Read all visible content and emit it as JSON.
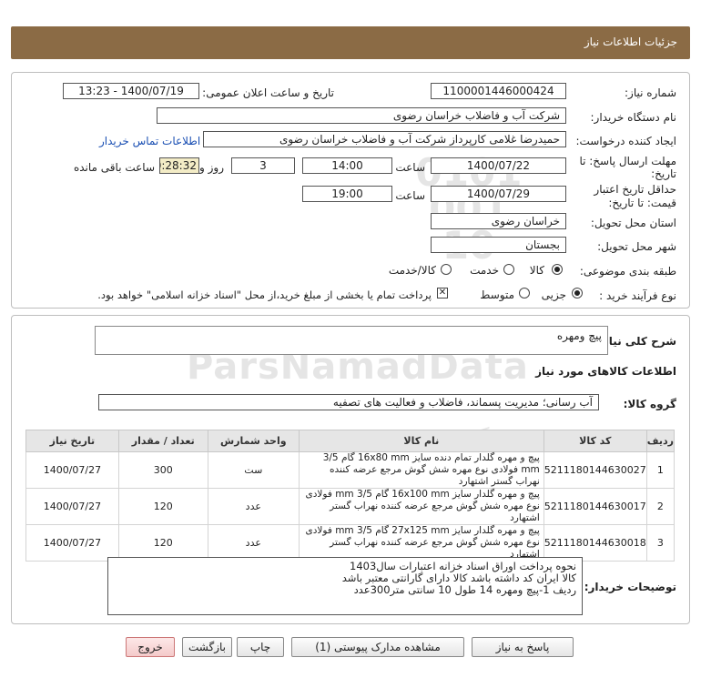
{
  "page": {
    "title": "جزئیات اطلاعات نیاز"
  },
  "form": {
    "need_number_label": "شماره نیاز:",
    "need_number": "1100001446000424",
    "announce_label": "تاریخ و ساعت اعلان عمومی:",
    "announce_value": "1400/07/19 - 13:23",
    "buyer_org_label": "نام دستگاه خریدار:",
    "buyer_org": "شرکت آب و فاضلاب خراسان رضوی",
    "creator_label": "ایجاد کننده درخواست:",
    "creator": "حمیدرضا غلامی کارپرداز شرکت آب و فاضلاب خراسان رضوی",
    "contact_link": "اطلاعات تماس خریدار",
    "deadline_label_1": "مهلت ارسال پاسخ: تا",
    "deadline_label_2": "تاریخ:",
    "deadline_date": "1400/07/22",
    "time_label": "ساعت",
    "deadline_time": "14:00",
    "days_count": "3",
    "days_label": "روز و",
    "remaining_time": "00:28:32",
    "remaining_label": "ساعت باقی مانده",
    "validity_label_1": "حداقل تاریخ اعتبار",
    "validity_label_2": "قیمت: تا تاریخ:",
    "validity_date": "1400/07/29",
    "validity_time_label": "ساعت",
    "validity_time": "19:00",
    "province_label": "استان محل تحویل:",
    "province": "خراسان رضوی",
    "city_label": "شهر محل تحویل:",
    "city": "بجستان",
    "category_label": "طبقه بندی موضوعی:",
    "category_options": [
      "کالا",
      "خدمت",
      "کالا/خدمت"
    ],
    "process_label": "نوع فرآیند خرید :",
    "process_options": [
      "جزیی",
      "متوسط"
    ],
    "payment_note": "پرداخت تمام یا بخشی از مبلغ خرید،از محل \"اسناد خزانه اسلامی\" خواهد بود."
  },
  "need": {
    "summary_label": "شرح کلی نیاز:",
    "summary": "پیچ ومهره",
    "goods_info_title": "اطلاعات کالاهای مورد نیاز",
    "group_label": "گروه کالا:",
    "group": "آب رسانی؛ مدیریت پسماند، فاضلاب و فعالیت های تصفیه"
  },
  "table": {
    "headers": [
      "ردیف",
      "کد کالا",
      "نام کالا",
      "واحد شمارش",
      "تعداد / مقدار",
      "تاریخ نیاز"
    ],
    "rows": [
      {
        "row": "1",
        "code": "5211180144630027",
        "name": "پیچ و مهره گلدار تمام دنده سایز 16x80 mm گام 3/5 mm فولادی نوع مهره شش گوش مرجع عرضه کننده نهراب گستر اشتهارد",
        "unit": "ست",
        "qty": "300",
        "date": "1400/07/27"
      },
      {
        "row": "2",
        "code": "5211180144630017",
        "name": "پیچ و مهره گلدار سایز 16x100 mm گام 3/5 mm فولادی نوع مهره شش گوش مرجع عرضه کننده نهراب گستر اشتهارد",
        "unit": "عدد",
        "qty": "120",
        "date": "1400/07/27"
      },
      {
        "row": "3",
        "code": "5211180144630018",
        "name": "پیچ و مهره گلدار سایز 27x125 mm گام 3/5 mm فولادی نوع مهره شش گوش مرجع عرضه کننده نهراب گستر اشتهارد",
        "unit": "عدد",
        "qty": "120",
        "date": "1400/07/27"
      }
    ]
  },
  "buyer_notes": {
    "label": "توضیحات خریدار:",
    "text": "نحوه پرداخت اوراق اسناد خزانه اعتبارات سال1403\nکالا ایران کد داشته باشد کالا دارای گارانتی معتبر باشد\nردیف 1-پیچ ومهره 14 طول 10 سانتی متر300عدد"
  },
  "buttons": {
    "reply": "پاسخ به نیاز",
    "view_docs": "مشاهده مدارک پیوستی (1)",
    "print": "چاپ",
    "back": "بازگشت",
    "exit": "خروج"
  },
  "watermark": {
    "brand": "ParsNamadData",
    "line1": "پایگاه اطلاع رسانی مناقصات",
    "phone": "۰۲۱ - ۸۸۳۴۹۶۷۰",
    "stamp_digits": "0101 001 10"
  },
  "colors": {
    "header_bg": "#8b6b45",
    "link": "#1a4fb3",
    "remaining_bg": "#f3ecc6",
    "exit_button": "#f4caca"
  }
}
